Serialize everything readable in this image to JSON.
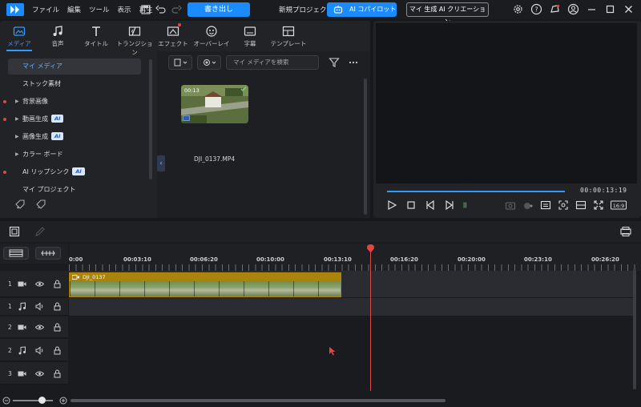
{
  "titlebar": {
    "menu": [
      "ファイル",
      "編集",
      "ツール",
      "表示",
      "再生"
    ],
    "export_label": "書き出し",
    "project_title": "新規プロジェクト (",
    "copilot_label": "AI コパイロット",
    "creation_label": "マイ 生成 AI クリエーション"
  },
  "tabs": [
    {
      "label": "メディア",
      "icon": "media-icon",
      "active": true
    },
    {
      "label": "音声",
      "icon": "music-icon"
    },
    {
      "label": "タイトル",
      "icon": "title-icon"
    },
    {
      "label": "トランジション",
      "icon": "transition-icon"
    },
    {
      "label": "エフェクト",
      "icon": "effect-icon"
    },
    {
      "label": "オーバーレイ",
      "icon": "overlay-icon"
    },
    {
      "label": "字幕",
      "icon": "subtitle-icon"
    },
    {
      "label": "テンプレート",
      "icon": "template-icon"
    }
  ],
  "sidebar": {
    "items": [
      {
        "label": "マイ メディア"
      },
      {
        "label": "ストック素材"
      },
      {
        "label": "背景画像"
      },
      {
        "label": "動画生成"
      },
      {
        "label": "画像生成"
      },
      {
        "label": "カラー ボード"
      },
      {
        "label": "AI リップシンク"
      },
      {
        "label": "マイ プロジェクト"
      }
    ],
    "ai_badge": "AI"
  },
  "library": {
    "search_placeholder": "マイ メディアを検索",
    "thumb_duration": "00:13",
    "file_name": "DJI_0137.MP4"
  },
  "preview": {
    "timecode": "00:00:13:19",
    "aspect": "16:9",
    "progress": 1.0
  },
  "timeline": {
    "ruler_labels": [
      "0:00",
      "00:03:10",
      "00:06:20",
      "00:10:00",
      "00:13:10",
      "00:16:20",
      "00:20:00",
      "00:23:10",
      "00:26:20"
    ],
    "clip_name": "DJI_0137",
    "tracks": [
      {
        "num": "1",
        "type": "video"
      },
      {
        "num": "1",
        "type": "audio"
      },
      {
        "num": "2",
        "type": "video"
      },
      {
        "num": "2",
        "type": "audio"
      },
      {
        "num": "3",
        "type": "video"
      }
    ]
  },
  "colors": {
    "accent": "#1a8cff",
    "playhead": "#e04646",
    "clip": "#a8840c"
  }
}
